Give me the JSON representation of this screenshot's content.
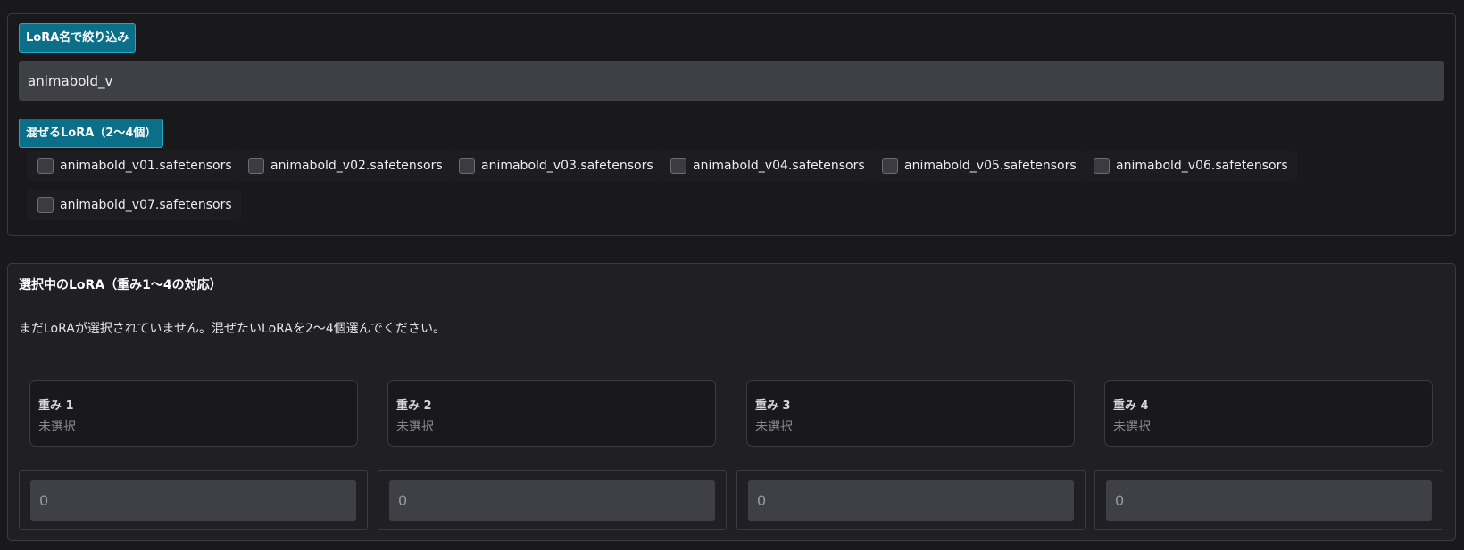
{
  "filter": {
    "label": "LoRA名で絞り込み",
    "value": "animabold_v"
  },
  "mix": {
    "label": "混ぜるLoRA（2〜4個）",
    "options": [
      {
        "label": "animabold_v01.safetensors",
        "checked": false
      },
      {
        "label": "animabold_v02.safetensors",
        "checked": false
      },
      {
        "label": "animabold_v03.safetensors",
        "checked": false
      },
      {
        "label": "animabold_v04.safetensors",
        "checked": false
      },
      {
        "label": "animabold_v05.safetensors",
        "checked": false
      },
      {
        "label": "animabold_v06.safetensors",
        "checked": false
      },
      {
        "label": "animabold_v07.safetensors",
        "checked": false
      }
    ]
  },
  "selected": {
    "title": "選択中のLoRA（重み1〜4の対応）",
    "empty_message": "まだLoRAが選択されていません。混ぜたいLoRAを2〜4個選んでください。",
    "slots": [
      {
        "label": "重み 1",
        "value": "未選択"
      },
      {
        "label": "重み 2",
        "value": "未選択"
      },
      {
        "label": "重み 3",
        "value": "未選択"
      },
      {
        "label": "重み 4",
        "value": "未選択"
      }
    ],
    "weights": [
      "0",
      "0",
      "0",
      "0"
    ]
  },
  "colors": {
    "background": "#19191c",
    "badge": "#0b6f8a",
    "input": "#3f3f46"
  }
}
